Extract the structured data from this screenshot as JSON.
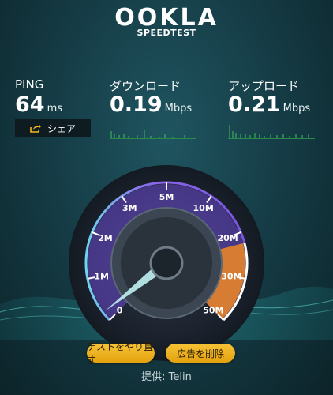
{
  "header": {
    "logo": "OOKLA",
    "subtitle": "SPEEDTEST"
  },
  "stats": {
    "ping": {
      "label": "PING",
      "value": "64",
      "unit": "ms"
    },
    "download": {
      "label": "ダウンロード",
      "value": "0.19",
      "unit": "Mbps"
    },
    "upload": {
      "label": "アップロード",
      "value": "0.21",
      "unit": "Mbps"
    }
  },
  "share": {
    "label": "シェア",
    "icon": "share-icon"
  },
  "gauge": {
    "ticks": [
      "0",
      "1M",
      "2M",
      "3M",
      "5M",
      "10M",
      "20M",
      "30M",
      "50M"
    ],
    "needle_value_mbps": 0.21,
    "colors": {
      "ring": "#7a5ce8",
      "active": "#f08a24",
      "needle": "#bfeff2"
    }
  },
  "buttons": {
    "retest": "テストをやり直す",
    "remove_ads": "広告を削除"
  },
  "provider": "提供: Telin"
}
